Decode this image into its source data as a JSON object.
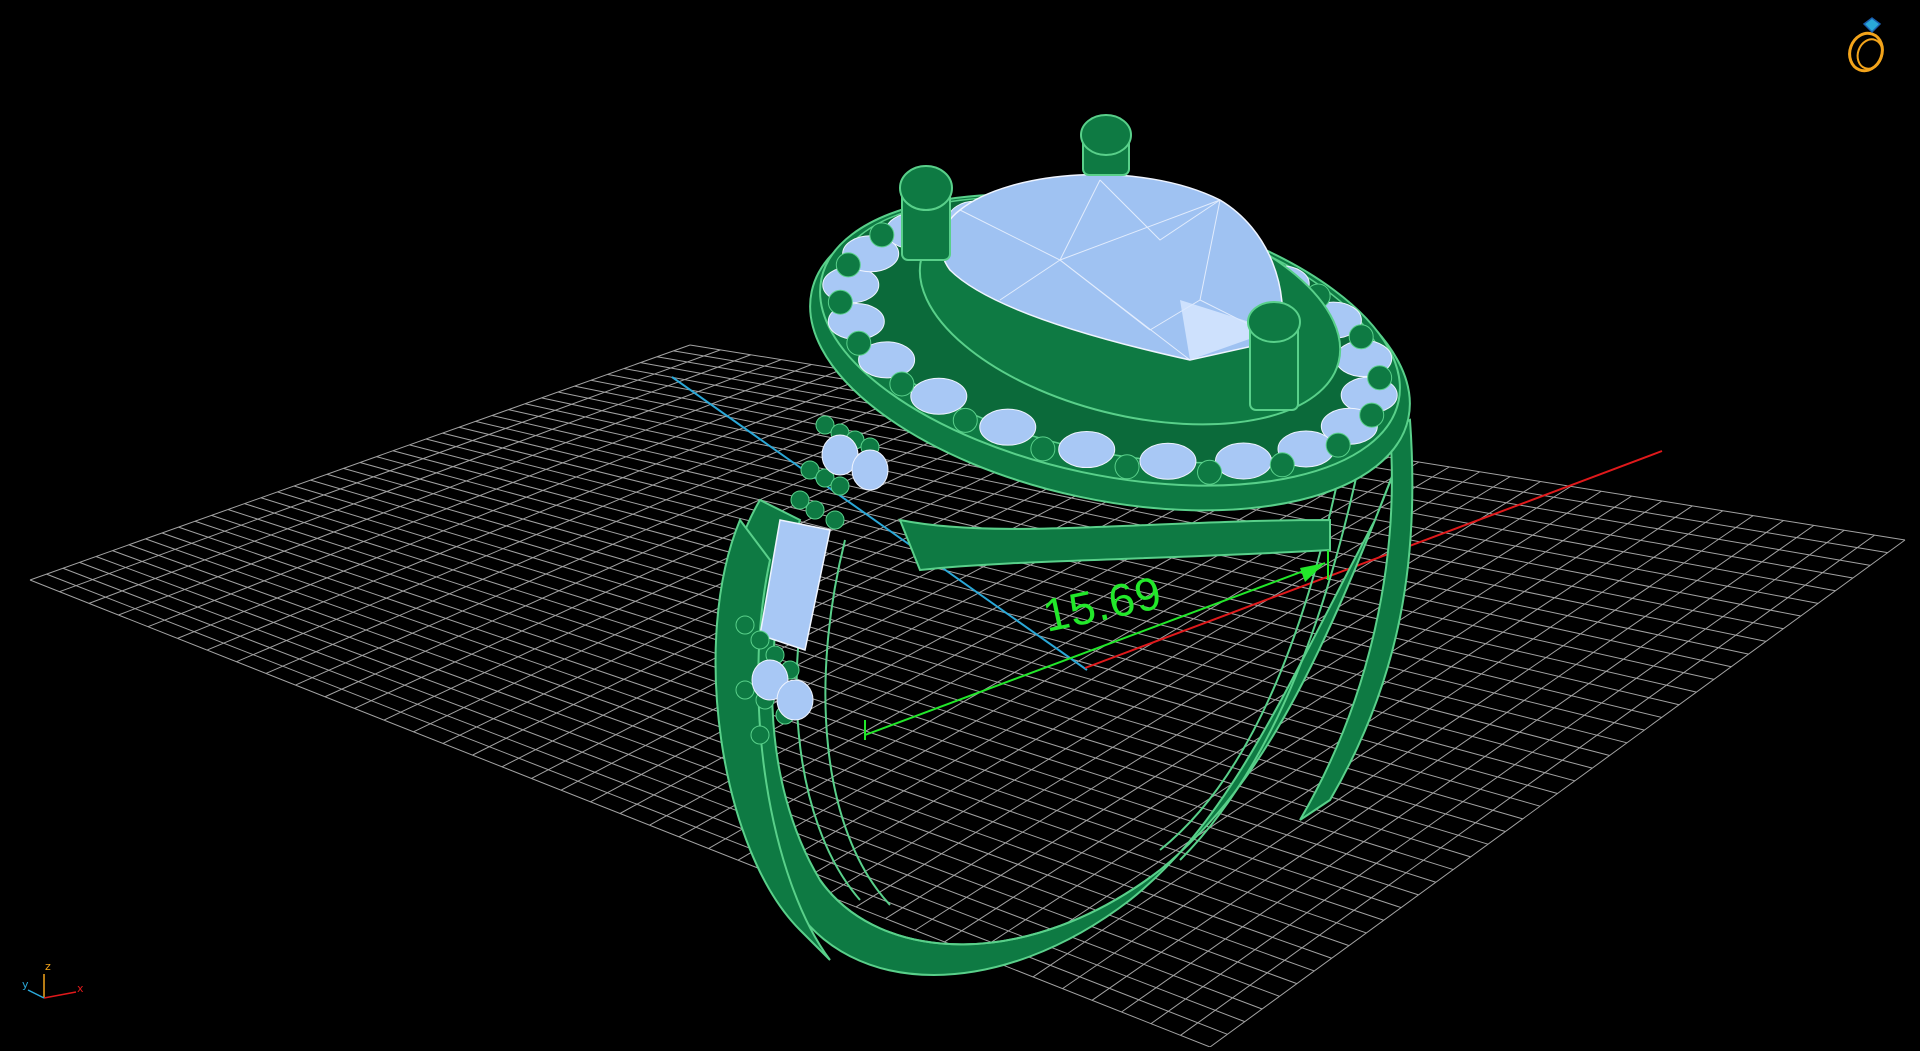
{
  "viewport": {
    "measurement": {
      "value": "15.69"
    },
    "axes": {
      "x": "x",
      "y": "y",
      "z": "z"
    },
    "grid": "on"
  },
  "colors": {
    "background": "#000000",
    "grid": "#bfbfbf",
    "metal": "#0e7a43",
    "metal_line": "#59d08a",
    "gem": "#a8c8f5",
    "gem_line": "#eef4ff",
    "measure": "#22e82a",
    "axis_x": "#e0191b",
    "axis_y": "#2aa8d8",
    "logo": "#f3a41b"
  },
  "icons": [
    "ring-logo-icon",
    "axis-triad-icon"
  ]
}
